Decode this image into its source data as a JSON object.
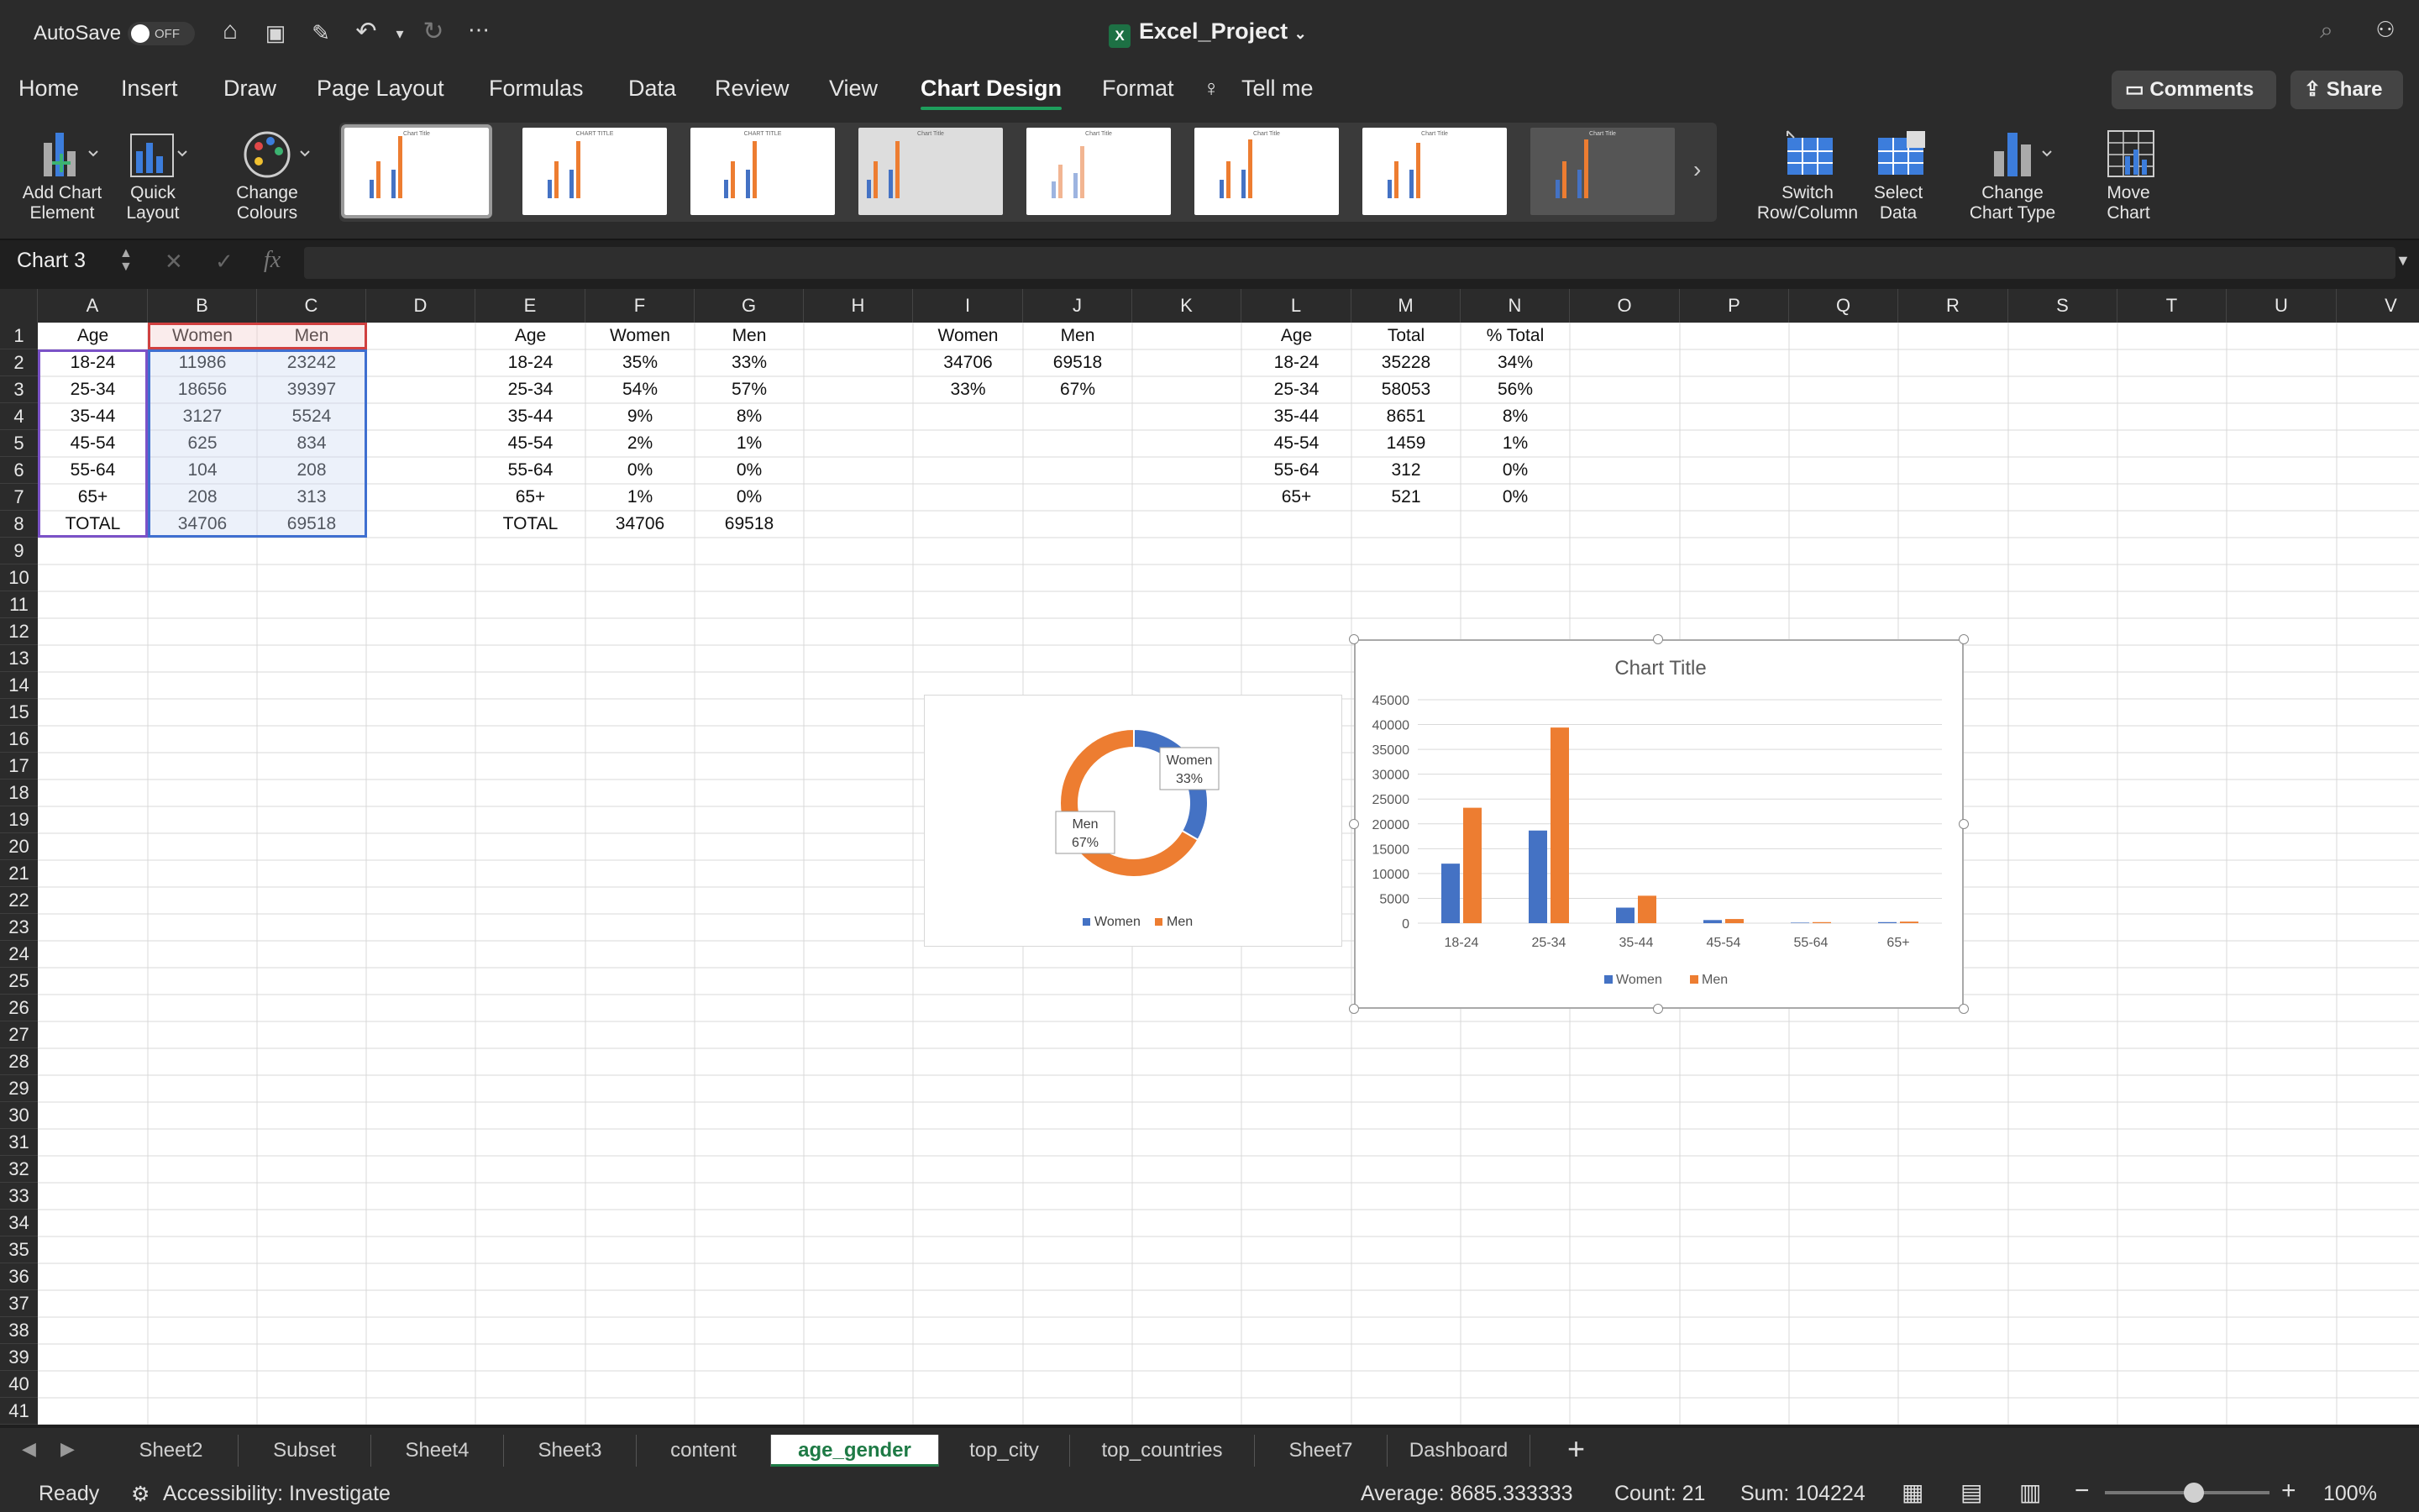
{
  "titlebar": {
    "autosave_label": "AutoSave",
    "autosave_state": "OFF",
    "doc_title": "Excel_Project",
    "doc_icon": "excel-icon"
  },
  "menu": {
    "tabs": [
      "Home",
      "Insert",
      "Draw",
      "Page Layout",
      "Formulas",
      "Data",
      "Review",
      "View",
      "Chart Design",
      "Format",
      "Tell me"
    ],
    "active": "Chart Design",
    "comments_label": "Comments",
    "share_label": "Share"
  },
  "ribbon": {
    "add_chart_element": "Add Chart\nElement",
    "quick_layout": "Quick\nLayout",
    "change_colours": "Change\nColours",
    "switch_rowcol": "Switch\nRow/Column",
    "select_data": "Select\nData",
    "change_chart_type": "Change\nChart Type",
    "move_chart": "Move\nChart",
    "gallery_titles": [
      "Chart Title",
      "CHART TITLE",
      "CHART TITLE",
      "Chart Title",
      "Chart Title",
      "Chart Title",
      "Chart Title",
      "Chart Title"
    ]
  },
  "formula": {
    "namebox": "Chart 3",
    "fx": "fx",
    "value": ""
  },
  "columns": [
    "A",
    "B",
    "C",
    "D",
    "E",
    "F",
    "G",
    "H",
    "I",
    "J",
    "K",
    "L",
    "M",
    "N",
    "O",
    "P",
    "Q",
    "R",
    "S",
    "T",
    "U",
    "V"
  ],
  "rows": [
    "1",
    "2",
    "3",
    "4",
    "5",
    "6",
    "7",
    "8",
    "9",
    "10",
    "11",
    "12",
    "13",
    "14",
    "15",
    "16",
    "17",
    "18",
    "19",
    "20",
    "21",
    "22",
    "23",
    "24",
    "25",
    "26",
    "27",
    "28",
    "29",
    "30",
    "31",
    "32",
    "33",
    "34",
    "35",
    "36",
    "37",
    "38",
    "39",
    "40",
    "41"
  ],
  "table_abc": [
    [
      "Age",
      "Women",
      "Men"
    ],
    [
      "18-24",
      "11986",
      "23242"
    ],
    [
      "25-34",
      "18656",
      "39397"
    ],
    [
      "35-44",
      "3127",
      "5524"
    ],
    [
      "45-54",
      "625",
      "834"
    ],
    [
      "55-64",
      "104",
      "208"
    ],
    [
      "65+",
      "208",
      "313"
    ],
    [
      "TOTAL",
      "34706",
      "69518"
    ]
  ],
  "table_efg": [
    [
      "Age",
      "Women",
      "Men"
    ],
    [
      "18-24",
      "35%",
      "33%"
    ],
    [
      "25-34",
      "54%",
      "57%"
    ],
    [
      "35-44",
      "9%",
      "8%"
    ],
    [
      "45-54",
      "2%",
      "1%"
    ],
    [
      "55-64",
      "0%",
      "0%"
    ],
    [
      "65+",
      "1%",
      "0%"
    ],
    [
      "TOTAL",
      "34706",
      "69518"
    ]
  ],
  "table_ij": [
    [
      "Women",
      "Men"
    ],
    [
      "34706",
      "69518"
    ],
    [
      "33%",
      "67%"
    ]
  ],
  "table_lmn": [
    [
      "Age",
      "Total",
      "% Total"
    ],
    [
      "18-24",
      "35228",
      "34%"
    ],
    [
      "25-34",
      "58053",
      "56%"
    ],
    [
      "35-44",
      "8651",
      "8%"
    ],
    [
      "45-54",
      "1459",
      "1%"
    ],
    [
      "55-64",
      "312",
      "0%"
    ],
    [
      "65+",
      "521",
      "0%"
    ]
  ],
  "colors": {
    "women": "#4472c4",
    "men": "#ed7d31"
  },
  "chart_data": [
    {
      "type": "pie",
      "variant": "doughnut",
      "title": "",
      "categories": [
        "Women",
        "Men"
      ],
      "values": [
        34706,
        69518
      ],
      "data_labels": [
        {
          "name": "Women",
          "pct": "33%"
        },
        {
          "name": "Men",
          "pct": "67%"
        }
      ],
      "legend": [
        "Women",
        "Men"
      ],
      "legend_position": "bottom"
    },
    {
      "type": "bar",
      "title": "Chart Title",
      "categories": [
        "18-24",
        "25-34",
        "35-44",
        "45-54",
        "55-64",
        "65+"
      ],
      "series": [
        {
          "name": "Women",
          "values": [
            11986,
            18656,
            3127,
            625,
            104,
            208
          ]
        },
        {
          "name": "Men",
          "values": [
            23242,
            39397,
            5524,
            834,
            208,
            313
          ]
        }
      ],
      "ylim": [
        0,
        45000
      ],
      "yticks": [
        "45000",
        "40000",
        "35000",
        "30000",
        "25000",
        "20000",
        "15000",
        "10000",
        "5000",
        "0"
      ],
      "grid": true,
      "legend_position": "bottom"
    }
  ],
  "sheets": [
    "Sheet2",
    "Subset",
    "Sheet4",
    "Sheet3",
    "content",
    "age_gender",
    "top_city",
    "top_countries",
    "Sheet7",
    "Dashboard"
  ],
  "active_sheet": "age_gender",
  "status": {
    "ready": "Ready",
    "accessibility": "Accessibility: Investigate",
    "average": "Average: 8685.333333",
    "count": "Count: 21",
    "sum": "Sum: 104224",
    "zoom": "100%",
    "zoom_level": 1.0
  }
}
